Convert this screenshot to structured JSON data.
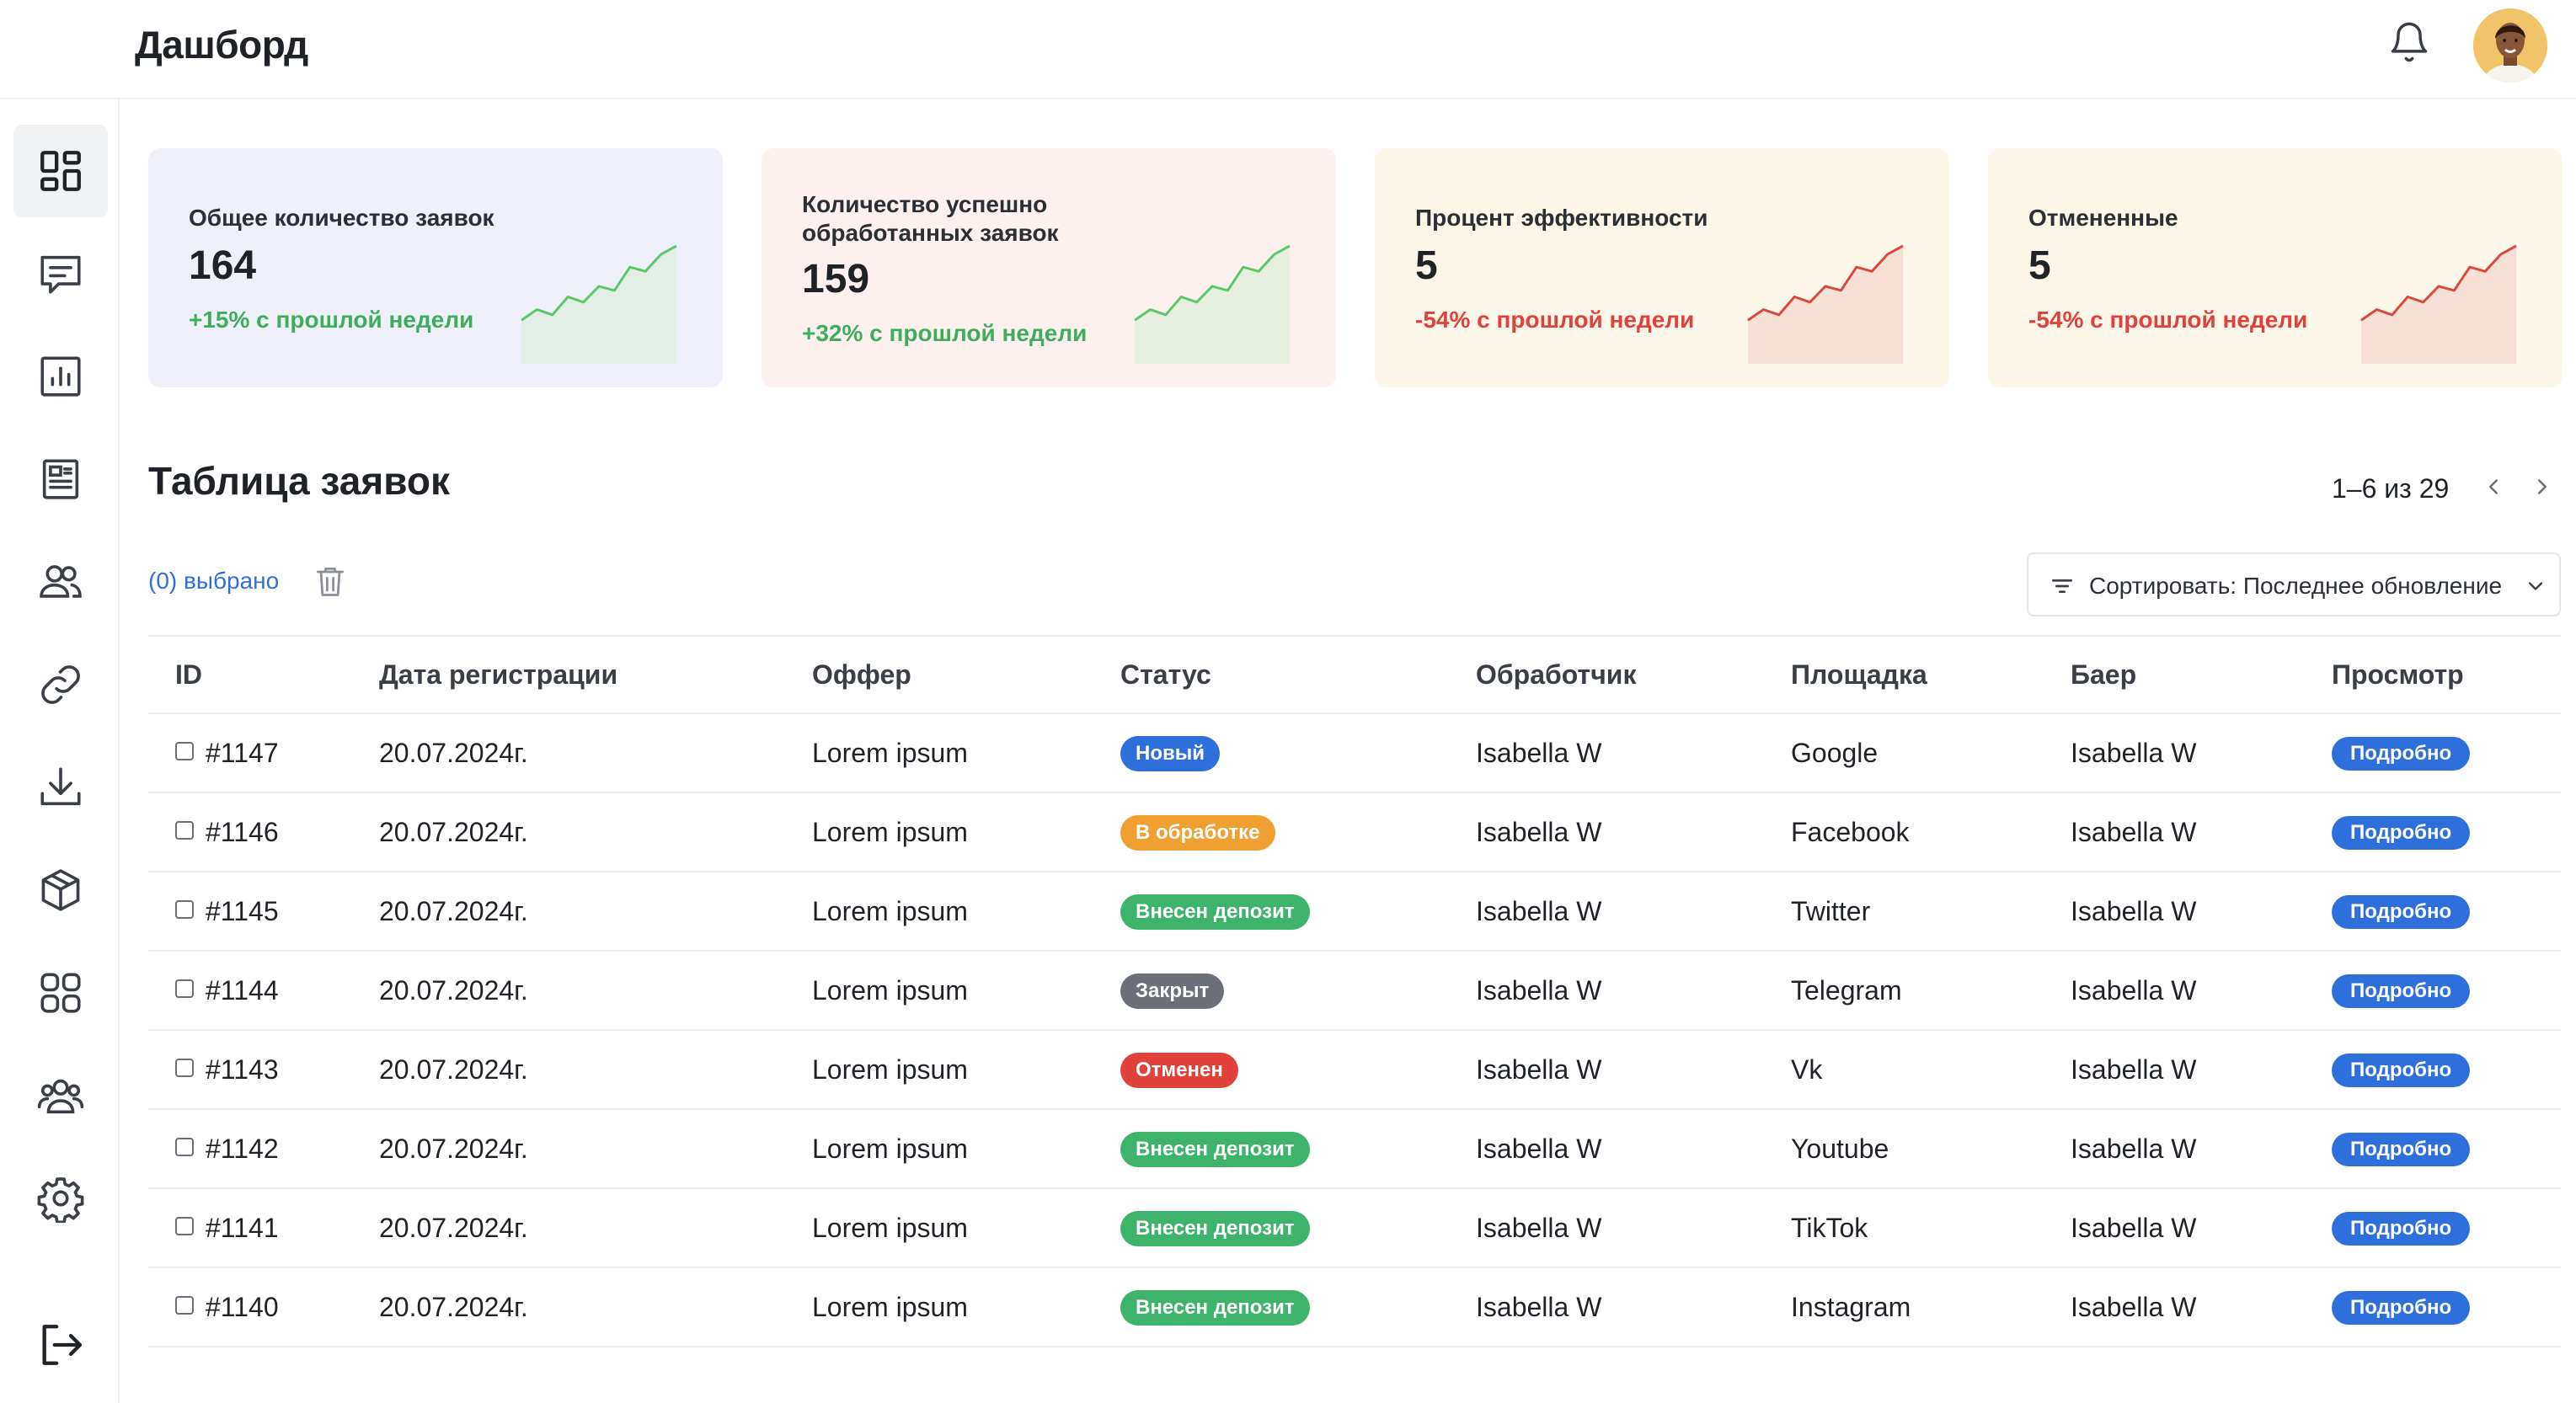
{
  "header": {
    "title": "Дашборд",
    "bell_icon": "bell-icon",
    "avatar_alt": "user-avatar"
  },
  "sidebar": {
    "items": [
      {
        "icon": "dashboard-grid-icon",
        "active": true
      },
      {
        "icon": "chat-icon",
        "active": false
      },
      {
        "icon": "chart-icon",
        "active": false
      },
      {
        "icon": "document-icon",
        "active": false
      },
      {
        "icon": "users-icon",
        "active": false
      },
      {
        "icon": "link-icon",
        "active": false
      },
      {
        "icon": "download-icon",
        "active": false
      },
      {
        "icon": "package-icon",
        "active": false
      },
      {
        "icon": "apps-icon",
        "active": false
      },
      {
        "icon": "team-icon",
        "active": false
      },
      {
        "icon": "settings-icon",
        "active": false
      },
      {
        "icon": "logout-icon",
        "active": false
      }
    ]
  },
  "cards": [
    {
      "label": "Общее количество заявок",
      "value": "164",
      "delta": "+15% с прошлой недели",
      "trend": "up",
      "bg": "#eff0fa",
      "line": "#5cc86a",
      "fill": "#e3efe6",
      "spark": [
        0.3,
        0.4,
        0.35,
        0.52,
        0.47,
        0.62,
        0.58,
        0.8,
        0.76,
        0.92,
        1.0
      ]
    },
    {
      "label": "Количество успешно обработанных заявок",
      "value": "159",
      "delta": "+32% с прошлой недели",
      "trend": "up",
      "bg": "#fcf1ee",
      "line": "#5cc86a",
      "fill": "#e7efe1",
      "spark": [
        0.3,
        0.4,
        0.35,
        0.52,
        0.47,
        0.62,
        0.58,
        0.8,
        0.76,
        0.92,
        1.0
      ]
    },
    {
      "label": "Процент эффективности",
      "value": "5",
      "delta": "-54% с прошлой недели",
      "trend": "down",
      "bg": "#fdf7ea",
      "line": "#d84a3a",
      "fill": "#f7e1d6",
      "spark": [
        0.3,
        0.4,
        0.35,
        0.52,
        0.47,
        0.62,
        0.58,
        0.8,
        0.76,
        0.92,
        1.0
      ]
    },
    {
      "label": "Отмененные",
      "value": "5",
      "delta": "-54% с прошлой недели",
      "trend": "down",
      "bg": "#fdf7ea",
      "line": "#d84a3a",
      "fill": "#f7e1d6",
      "spark": [
        0.3,
        0.4,
        0.35,
        0.52,
        0.47,
        0.62,
        0.58,
        0.8,
        0.76,
        0.92,
        1.0
      ]
    }
  ],
  "table_section": {
    "title": "Таблица заявок",
    "pager_text": "1–6 из 29",
    "selected_text": "(0) выбрано",
    "sort_label": "Сортировать: Последнее обновление"
  },
  "table": {
    "columns": [
      "ID",
      "Дата регистрации",
      "Оффер",
      "Статус",
      "Обработчик",
      "Площадка",
      "Баер",
      "Просмотр"
    ],
    "view_label": "Подробно",
    "rows": [
      {
        "id": "#1147",
        "date": "20.07.2024г.",
        "offer": "Lorem ipsum",
        "status": "Новый",
        "status_color": "#2f6fdc",
        "handler": "Isabella W",
        "platform": "Google",
        "buyer": "Isabella W"
      },
      {
        "id": "#1146",
        "date": "20.07.2024г.",
        "offer": "Lorem ipsum",
        "status": "В обработке",
        "status_color": "#f0a030",
        "handler": "Isabella W",
        "platform": "Facebook",
        "buyer": "Isabella W"
      },
      {
        "id": "#1145",
        "date": "20.07.2024г.",
        "offer": "Lorem ipsum",
        "status": "Внесен депозит",
        "status_color": "#3eb36a",
        "handler": "Isabella W",
        "platform": "Twitter",
        "buyer": "Isabella W"
      },
      {
        "id": "#1144",
        "date": "20.07.2024г.",
        "offer": "Lorem ipsum",
        "status": "Закрыт",
        "status_color": "#6b7078",
        "handler": "Isabella W",
        "platform": "Telegram",
        "buyer": "Isabella W"
      },
      {
        "id": "#1143",
        "date": "20.07.2024г.",
        "offer": "Lorem ipsum",
        "status": "Отменен",
        "status_color": "#e0413b",
        "handler": "Isabella W",
        "platform": "Vk",
        "buyer": "Isabella W"
      },
      {
        "id": "#1142",
        "date": "20.07.2024г.",
        "offer": "Lorem ipsum",
        "status": "Внесен депозит",
        "status_color": "#3eb36a",
        "handler": "Isabella W",
        "platform": "Youtube",
        "buyer": "Isabella W"
      },
      {
        "id": "#1141",
        "date": "20.07.2024г.",
        "offer": "Lorem ipsum",
        "status": "Внесен депозит",
        "status_color": "#3eb36a",
        "handler": "Isabella W",
        "platform": "TikTok",
        "buyer": "Isabella W"
      },
      {
        "id": "#1140",
        "date": "20.07.2024г.",
        "offer": "Lorem ipsum",
        "status": "Внесен депозит",
        "status_color": "#3eb36a",
        "handler": "Isabella W",
        "platform": "Instagram",
        "buyer": "Isabella W"
      }
    ]
  }
}
